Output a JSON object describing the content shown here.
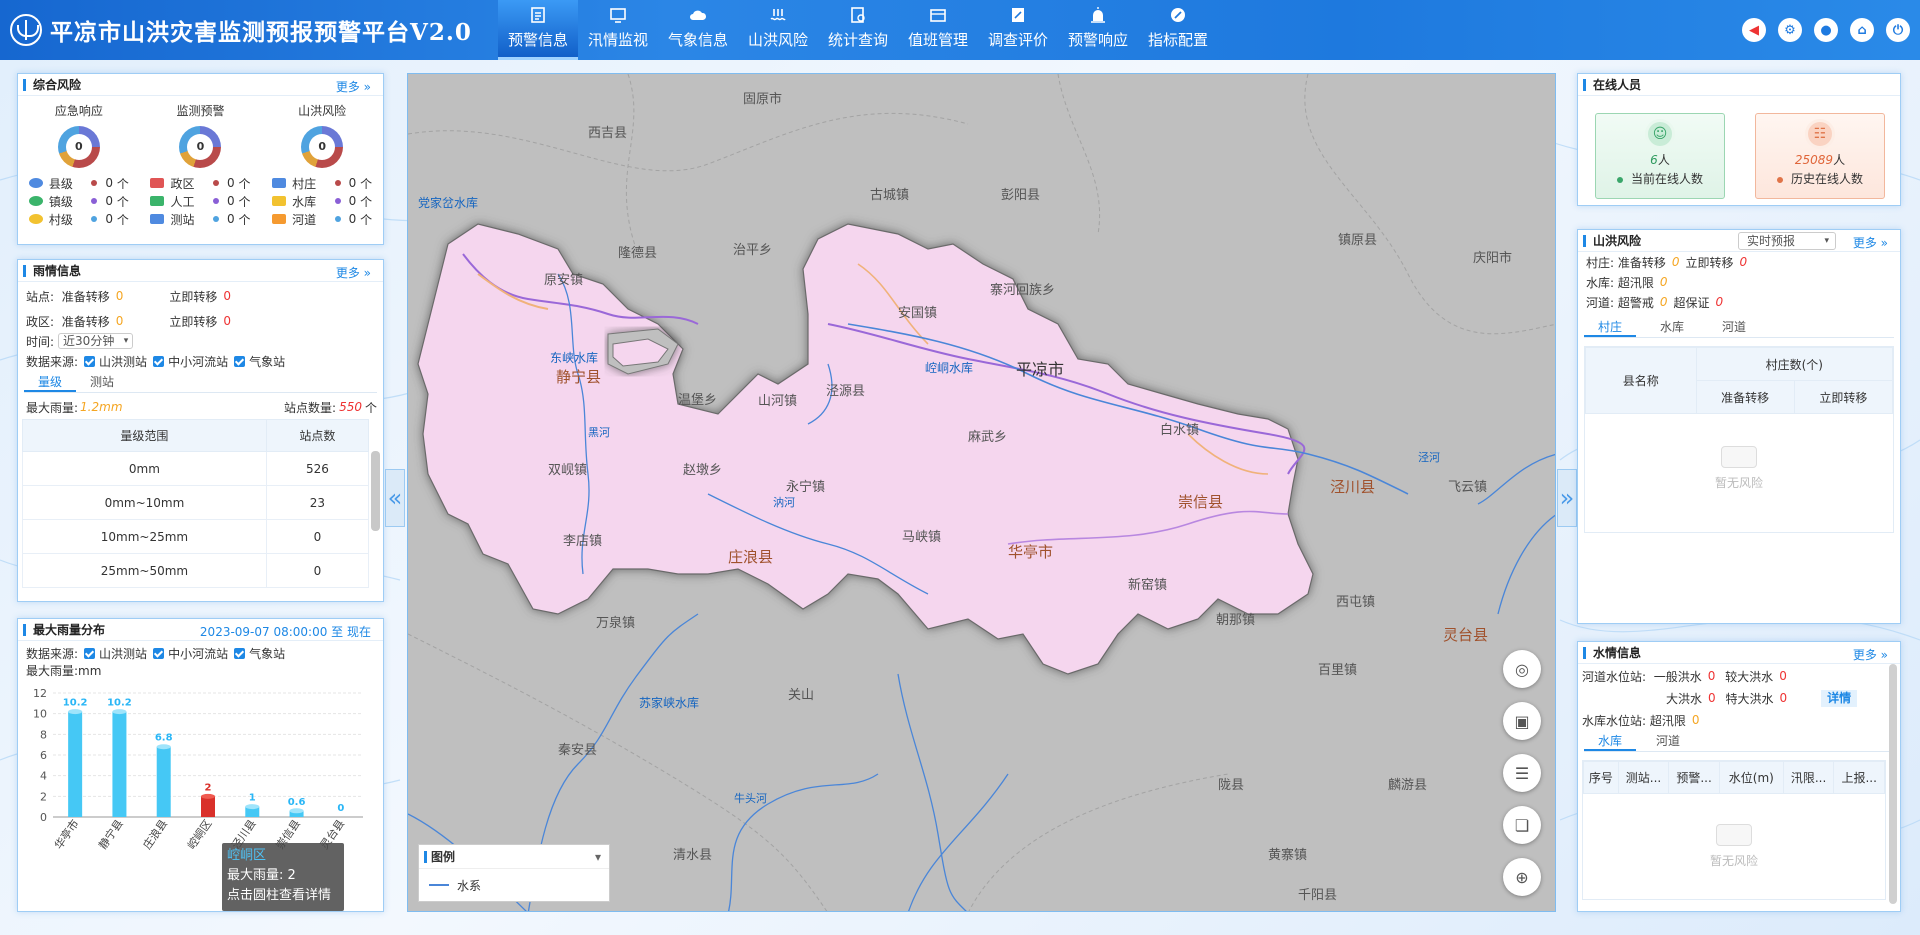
{
  "header": {
    "title": "平凉市山洪灾害监测预报预警平台V2.0",
    "nav": [
      {
        "label": "预警信息",
        "active": true,
        "icon": "warning-doc-icon"
      },
      {
        "label": "汛情监视",
        "icon": "monitor-icon"
      },
      {
        "label": "气象信息",
        "icon": "cloud-icon"
      },
      {
        "label": "山洪风险",
        "icon": "flood-icon"
      },
      {
        "label": "统计查询",
        "icon": "stats-icon"
      },
      {
        "label": "值班管理",
        "icon": "duty-icon"
      },
      {
        "label": "调查评价",
        "icon": "survey-icon"
      },
      {
        "label": "预警响应",
        "icon": "alarm-icon"
      },
      {
        "label": "指标配置",
        "icon": "config-icon"
      }
    ]
  },
  "risk": {
    "title": "综合风险",
    "more": "更多",
    "groups": [
      {
        "title": "应急响应",
        "value": "0",
        "items": [
          {
            "label": "县级",
            "v": "0",
            "u": "个"
          },
          {
            "label": "镇级",
            "v": "0",
            "u": "个"
          },
          {
            "label": "村级",
            "v": "0",
            "u": "个"
          }
        ]
      },
      {
        "title": "监测预警",
        "value": "0",
        "items": [
          {
            "label": "政区",
            "v": "0",
            "u": "个"
          },
          {
            "label": "人工",
            "v": "0",
            "u": "个"
          },
          {
            "label": "测站",
            "v": "0",
            "u": "个"
          }
        ]
      },
      {
        "title": "山洪风险",
        "value": "0",
        "items": [
          {
            "label": "村庄",
            "v": "0",
            "u": "个"
          },
          {
            "label": "水库",
            "v": "0",
            "u": "个"
          },
          {
            "label": "河道",
            "v": "0",
            "u": "个"
          }
        ]
      }
    ]
  },
  "rain": {
    "title": "雨情信息",
    "more": "更多",
    "station_label": "站点:",
    "prep": "准备转移",
    "prep_val": "0",
    "now": "立即转移",
    "now_val": "0",
    "region_label": "政区:",
    "region_prep_val": "0",
    "region_now_val": "0",
    "time_label": "时间:",
    "time_value": "近30分钟",
    "source_label": "数据来源:",
    "sources": [
      "山洪测站",
      "中小河流站",
      "气象站"
    ],
    "tabs": [
      "量级",
      "测站"
    ],
    "max_label": "最大雨量:",
    "max_val": "1.2mm",
    "count_label": "站点数量:",
    "count_val": "550",
    "count_unit": "个",
    "table": {
      "headers": [
        "量级范围",
        "站点数"
      ],
      "rows": [
        [
          "0mm",
          "526"
        ],
        [
          "0mm~10mm",
          "23"
        ],
        [
          "10mm~25mm",
          "0"
        ],
        [
          "25mm~50mm",
          "0"
        ]
      ]
    }
  },
  "maxrain": {
    "title": "最大雨量分布",
    "time": "2023-09-07 08:00:00 至 现在",
    "source_label": "数据来源:",
    "sources": [
      "山洪测站",
      "中小河流站",
      "气象站"
    ],
    "unit_label": "最大雨量:mm",
    "tooltip": {
      "name": "崆峒区",
      "line1": "最大雨量: 2",
      "line2": "点击圆柱查看详情"
    }
  },
  "chart_data": {
    "type": "bar",
    "categories": [
      "华亭市",
      "静宁县",
      "庄浪县",
      "崆峒区",
      "泾川县",
      "崇信县",
      "灵台县"
    ],
    "values": [
      10.2,
      10.2,
      6.8,
      2,
      1,
      0.6,
      0
    ],
    "ylim": [
      0,
      12
    ],
    "yticks": [
      0,
      2,
      4,
      6,
      8,
      10,
      12
    ]
  },
  "online": {
    "title": "在线人员",
    "current_val": "6",
    "current_unit": "人",
    "current_label": "当前在线人数",
    "hist_val": "25089",
    "hist_unit": "人",
    "hist_label": "历史在线人数"
  },
  "flood": {
    "title": "山洪风险",
    "more": "更多",
    "select": "实时预报",
    "village_label": "村庄:",
    "prep": "准备转移",
    "prep_val": "0",
    "now": "立即转移",
    "now_val": "0",
    "res_label": "水库:",
    "res_text": "超汛限",
    "res_val": "0",
    "river_label": "河道:",
    "river_t1": "超警戒",
    "river_v1": "0",
    "river_t2": "超保证",
    "river_v2": "0",
    "tabs": [
      "村庄",
      "水库",
      "河道"
    ],
    "th_county": "县名称",
    "th_group": "村庄数(个)",
    "th_prep": "准备转移",
    "th_now": "立即转移",
    "empty": "暂无风险"
  },
  "water": {
    "title": "水情信息",
    "more": "更多",
    "river_label": "河道水位站:",
    "r1": "一般洪水",
    "r1v": "0",
    "r2": "较大洪水",
    "r2v": "0",
    "r3": "大洪水",
    "r3v": "0",
    "r4": "特大洪水",
    "r4v": "0",
    "detail": "详情",
    "res_label": "水库水位站:",
    "res_text": "超汛限",
    "res_val": "0",
    "tabs": [
      "水库",
      "河道"
    ],
    "cols": [
      "序号",
      "测站...",
      "预警...",
      "水位(m)",
      "汛限...",
      "上报..."
    ],
    "empty": "暂无风险"
  },
  "map": {
    "legend_title": "图例",
    "legend_item": "水系",
    "labels": [
      "固原市",
      "西吉县",
      "党家岔水库",
      "隆德县",
      "静宁县",
      "东峡水库",
      "原安镇",
      "治平乡",
      "双岘镇",
      "赵墩乡",
      "温堡乡",
      "李店镇",
      "庄浪县",
      "永宁镇",
      "万泉镇",
      "山河镇",
      "泾源县",
      "崆峒水库",
      "平凉市",
      "麻武乡",
      "安国镇",
      "寨河回族乡",
      "白水镇",
      "崇信县",
      "泾川县",
      "飞云镇",
      "马峡镇",
      "华亭市",
      "新窑镇",
      "朝那镇",
      "西屯镇",
      "百里镇",
      "灵台县",
      "苏家峡水库",
      "彭阳县",
      "古城镇",
      "镇原县",
      "庆阳市",
      "泾河",
      "汭河",
      "黑河",
      "牛头河",
      "关山",
      "秦安县",
      "清水县",
      "麟游县",
      "千阳县",
      "陇县",
      "黄寨镇"
    ]
  }
}
